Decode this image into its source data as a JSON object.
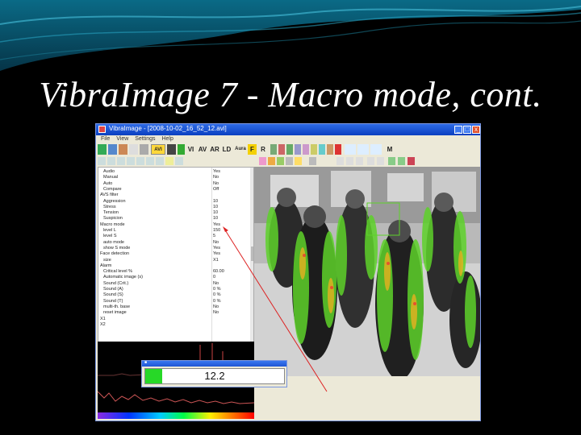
{
  "slide": {
    "title": "VibraImage 7 - Macro mode, cont."
  },
  "window": {
    "title": "VibraImage - [2008-10-02_16_52_12.avi]",
    "minimize_label": "_",
    "maximize_label": "□",
    "close_label": "x"
  },
  "menu": [
    "File",
    "View",
    "Settings",
    "Help"
  ],
  "toolbar": {
    "avi_label": "AVI",
    "labels": [
      "VI",
      "AV",
      "AR",
      "LD",
      "Aura",
      "F",
      "R",
      "M"
    ]
  },
  "properties": {
    "rows": [
      {
        "name": "Audio",
        "value": "Yes",
        "cat": false
      },
      {
        "name": "Manual",
        "value": "No",
        "cat": false
      },
      {
        "name": "Auto",
        "value": "No",
        "cat": false
      },
      {
        "name": "Compare",
        "value": "Off",
        "cat": false
      },
      {
        "name": "AVS filter",
        "value": "",
        "cat": true
      },
      {
        "name": "Aggression",
        "value": "10",
        "cat": false
      },
      {
        "name": "Stress",
        "value": "10",
        "cat": false
      },
      {
        "name": "Tension",
        "value": "10",
        "cat": false
      },
      {
        "name": "Suspicion",
        "value": "10",
        "cat": false
      },
      {
        "name": "Macro mode",
        "value": "Yes",
        "cat": true
      },
      {
        "name": "level L",
        "value": "150",
        "cat": false
      },
      {
        "name": "level S",
        "value": "5",
        "cat": false
      },
      {
        "name": "auto mode",
        "value": "No",
        "cat": false
      },
      {
        "name": "show S mode",
        "value": "Yes",
        "cat": false
      },
      {
        "name": "Face detection",
        "value": "Yes",
        "cat": true
      },
      {
        "name": "size",
        "value": "X1",
        "cat": false
      },
      {
        "name": "Alarm",
        "value": "",
        "cat": true
      },
      {
        "name": "Critical level %",
        "value": "60.00",
        "cat": false
      },
      {
        "name": "Automatic image (s)",
        "value": "0",
        "cat": false
      },
      {
        "name": "Sound (Crit.)",
        "value": "No",
        "cat": false
      },
      {
        "name": "Sound (A)",
        "value": "0 %",
        "cat": false
      },
      {
        "name": "Sound (S)",
        "value": "0 %",
        "cat": false
      },
      {
        "name": "Sound (T)",
        "value": "0 %",
        "cat": false
      },
      {
        "name": "multi-th. base",
        "value": "No",
        "cat": false
      },
      {
        "name": "reset image",
        "value": "No",
        "cat": false
      },
      {
        "name": "X1",
        "value": "",
        "cat": true
      },
      {
        "name": "X2",
        "value": "",
        "cat": true
      }
    ]
  },
  "gauge": {
    "value": "12.2",
    "fill_fraction": 0.12,
    "fill_color": "#27d827"
  },
  "colors": {
    "slide_bg": "#000000",
    "banner_top": "#0a6a86",
    "title_text": "#ffffff"
  }
}
